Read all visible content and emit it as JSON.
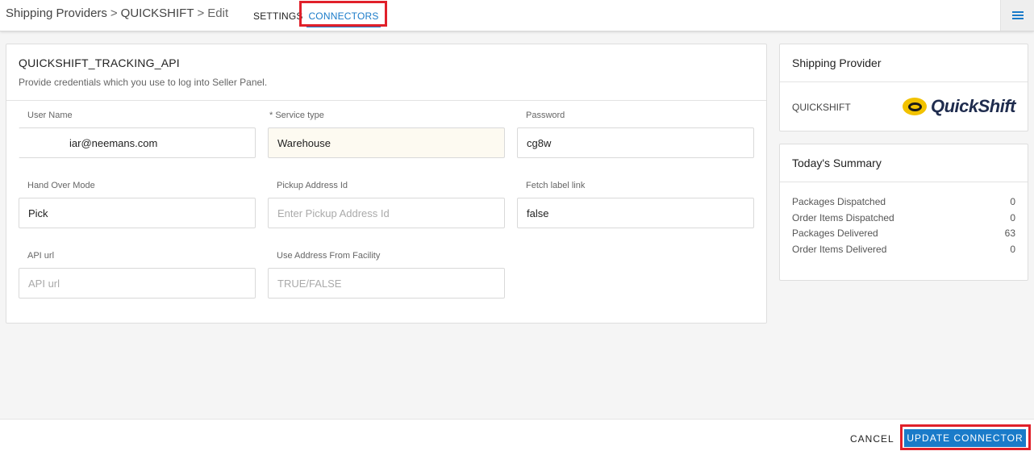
{
  "breadcrumb": {
    "root": "Shipping Providers",
    "provider": "QUICKSHIFT",
    "current": "Edit",
    "separator": ">"
  },
  "tabs": {
    "settings": "SETTINGS",
    "connectors": "CONNECTORS"
  },
  "connector": {
    "title": "QUICKSHIFT_TRACKING_API",
    "subtitle": "Provide credentials which you use to log into Seller Panel.",
    "fields": {
      "user_name": {
        "label": "User Name",
        "value": "iar@neemans.com"
      },
      "service_type": {
        "label": "* Service type",
        "value": "Warehouse"
      },
      "password": {
        "label": "Password",
        "value": "cg8w"
      },
      "hand_over_mode": {
        "label": "Hand Over Mode",
        "value": "Pick"
      },
      "pickup_address_id": {
        "label": "Pickup Address Id",
        "placeholder": "Enter Pickup Address Id"
      },
      "fetch_label_link": {
        "label": "Fetch label link",
        "value": "false"
      },
      "api_url": {
        "label": "API url",
        "placeholder": "API url"
      },
      "use_address_from_facility": {
        "label": "Use Address From Facility",
        "placeholder": "TRUE/FALSE"
      }
    }
  },
  "provider_card": {
    "title": "Shipping Provider",
    "name": "QUICKSHIFT",
    "logo_text": "QuickShift"
  },
  "summary": {
    "title": "Today's Summary",
    "rows": [
      {
        "label": "Packages Dispatched",
        "value": "0"
      },
      {
        "label": "Order Items Dispatched",
        "value": "0"
      },
      {
        "label": "Packages Delivered",
        "value": "63"
      },
      {
        "label": "Order Items Delivered",
        "value": "0"
      }
    ]
  },
  "footer": {
    "cancel": "CANCEL",
    "update": "UPDATE CONNECTOR"
  },
  "colors": {
    "accent": "#1a7bc9",
    "highlight": "#e0202a",
    "logo_yellow": "#f2c200"
  },
  "icons": {
    "menu": "hamburger-menu-icon",
    "logo": "quickshift-logo-icon"
  }
}
